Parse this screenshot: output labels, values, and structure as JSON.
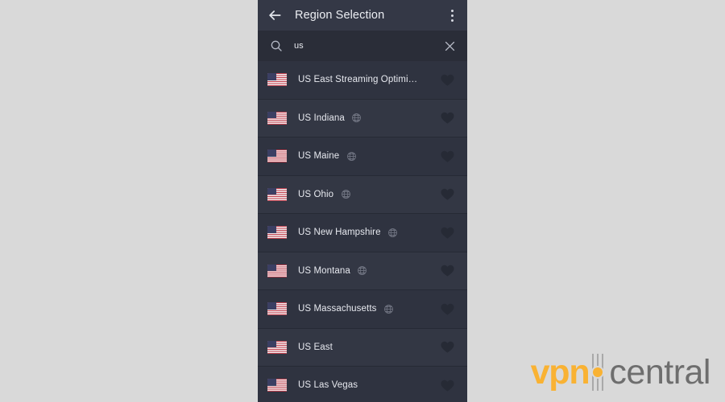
{
  "app_bar": {
    "back_icon": "back-arrow-icon",
    "title": "Region Selection",
    "overflow_icon": "more-vertical-icon"
  },
  "search": {
    "icon": "search-icon",
    "value": "us",
    "placeholder": "Search",
    "clear_icon": "close-icon"
  },
  "regions": [
    {
      "name": "US East Streaming Optimi…",
      "flag": "us-flag-icon",
      "geo": false,
      "favorite_icon": "heart-icon"
    },
    {
      "name": "US Indiana",
      "flag": "us-flag-icon",
      "geo": true,
      "favorite_icon": "heart-icon"
    },
    {
      "name": "US Maine",
      "flag": "us-flag-icon",
      "geo": true,
      "favorite_icon": "heart-icon"
    },
    {
      "name": "US Ohio",
      "flag": "us-flag-icon",
      "geo": true,
      "favorite_icon": "heart-icon"
    },
    {
      "name": "US New Hampshire",
      "flag": "us-flag-icon",
      "geo": true,
      "favorite_icon": "heart-icon"
    },
    {
      "name": "US Montana",
      "flag": "us-flag-icon",
      "geo": true,
      "favorite_icon": "heart-icon"
    },
    {
      "name": "US Massachusetts",
      "flag": "us-flag-icon",
      "geo": true,
      "favorite_icon": "heart-icon"
    },
    {
      "name": "US East",
      "flag": "us-flag-icon",
      "geo": false,
      "favorite_icon": "heart-icon"
    },
    {
      "name": "US Las Vegas",
      "flag": "us-flag-icon",
      "geo": false,
      "favorite_icon": "heart-icon"
    }
  ],
  "watermark": {
    "text_primary": "vpn",
    "text_secondary": "central",
    "color_primary": "#f9b233",
    "color_secondary": "#6e6e6e"
  },
  "colors": {
    "page_background": "#d9d9d9",
    "panel_background": "#2f3340",
    "app_bar_background": "#343846",
    "search_background": "#2a2d38",
    "row_alt_background": "#333744",
    "divider": "#262a35",
    "text_primary": "#e7e9ef",
    "heart": "#262a35"
  }
}
